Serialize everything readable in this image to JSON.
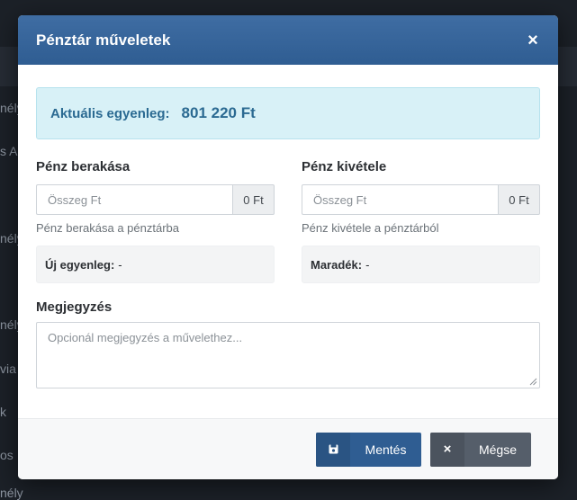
{
  "background": {
    "fragments": [
      "nélyi",
      "s Al",
      "nély",
      "nély",
      "via",
      "k",
      "os",
      "nély"
    ]
  },
  "modal": {
    "title": "Pénztár műveletek",
    "close_label": "×"
  },
  "balance": {
    "label": "Aktuális egyenleg:",
    "value": "801 220 Ft"
  },
  "deposit": {
    "title": "Pénz berakása",
    "placeholder": "Összeg Ft",
    "addon": "0 Ft",
    "help": "Pénz berakása a pénztárba",
    "result_label": "Új egyenleg:",
    "result_value": "-"
  },
  "withdraw": {
    "title": "Pénz kivétele",
    "placeholder": "Összeg Ft",
    "addon": "0 Ft",
    "help": "Pénz kivétele a pénztárból",
    "result_label": "Maradék:",
    "result_value": "-"
  },
  "notes": {
    "title": "Megjegyzés",
    "placeholder": "Opcionál megjegyzés a művelethez..."
  },
  "footer": {
    "save_label": "Mentés",
    "cancel_label": "Mégse",
    "save_icon": "save-icon",
    "cancel_icon": "x-icon"
  },
  "colors": {
    "header": "#2f5d92",
    "accent_text": "#2b6a92",
    "balance_bg": "#d8f1f7",
    "cancel_btn": "#555e6a"
  }
}
